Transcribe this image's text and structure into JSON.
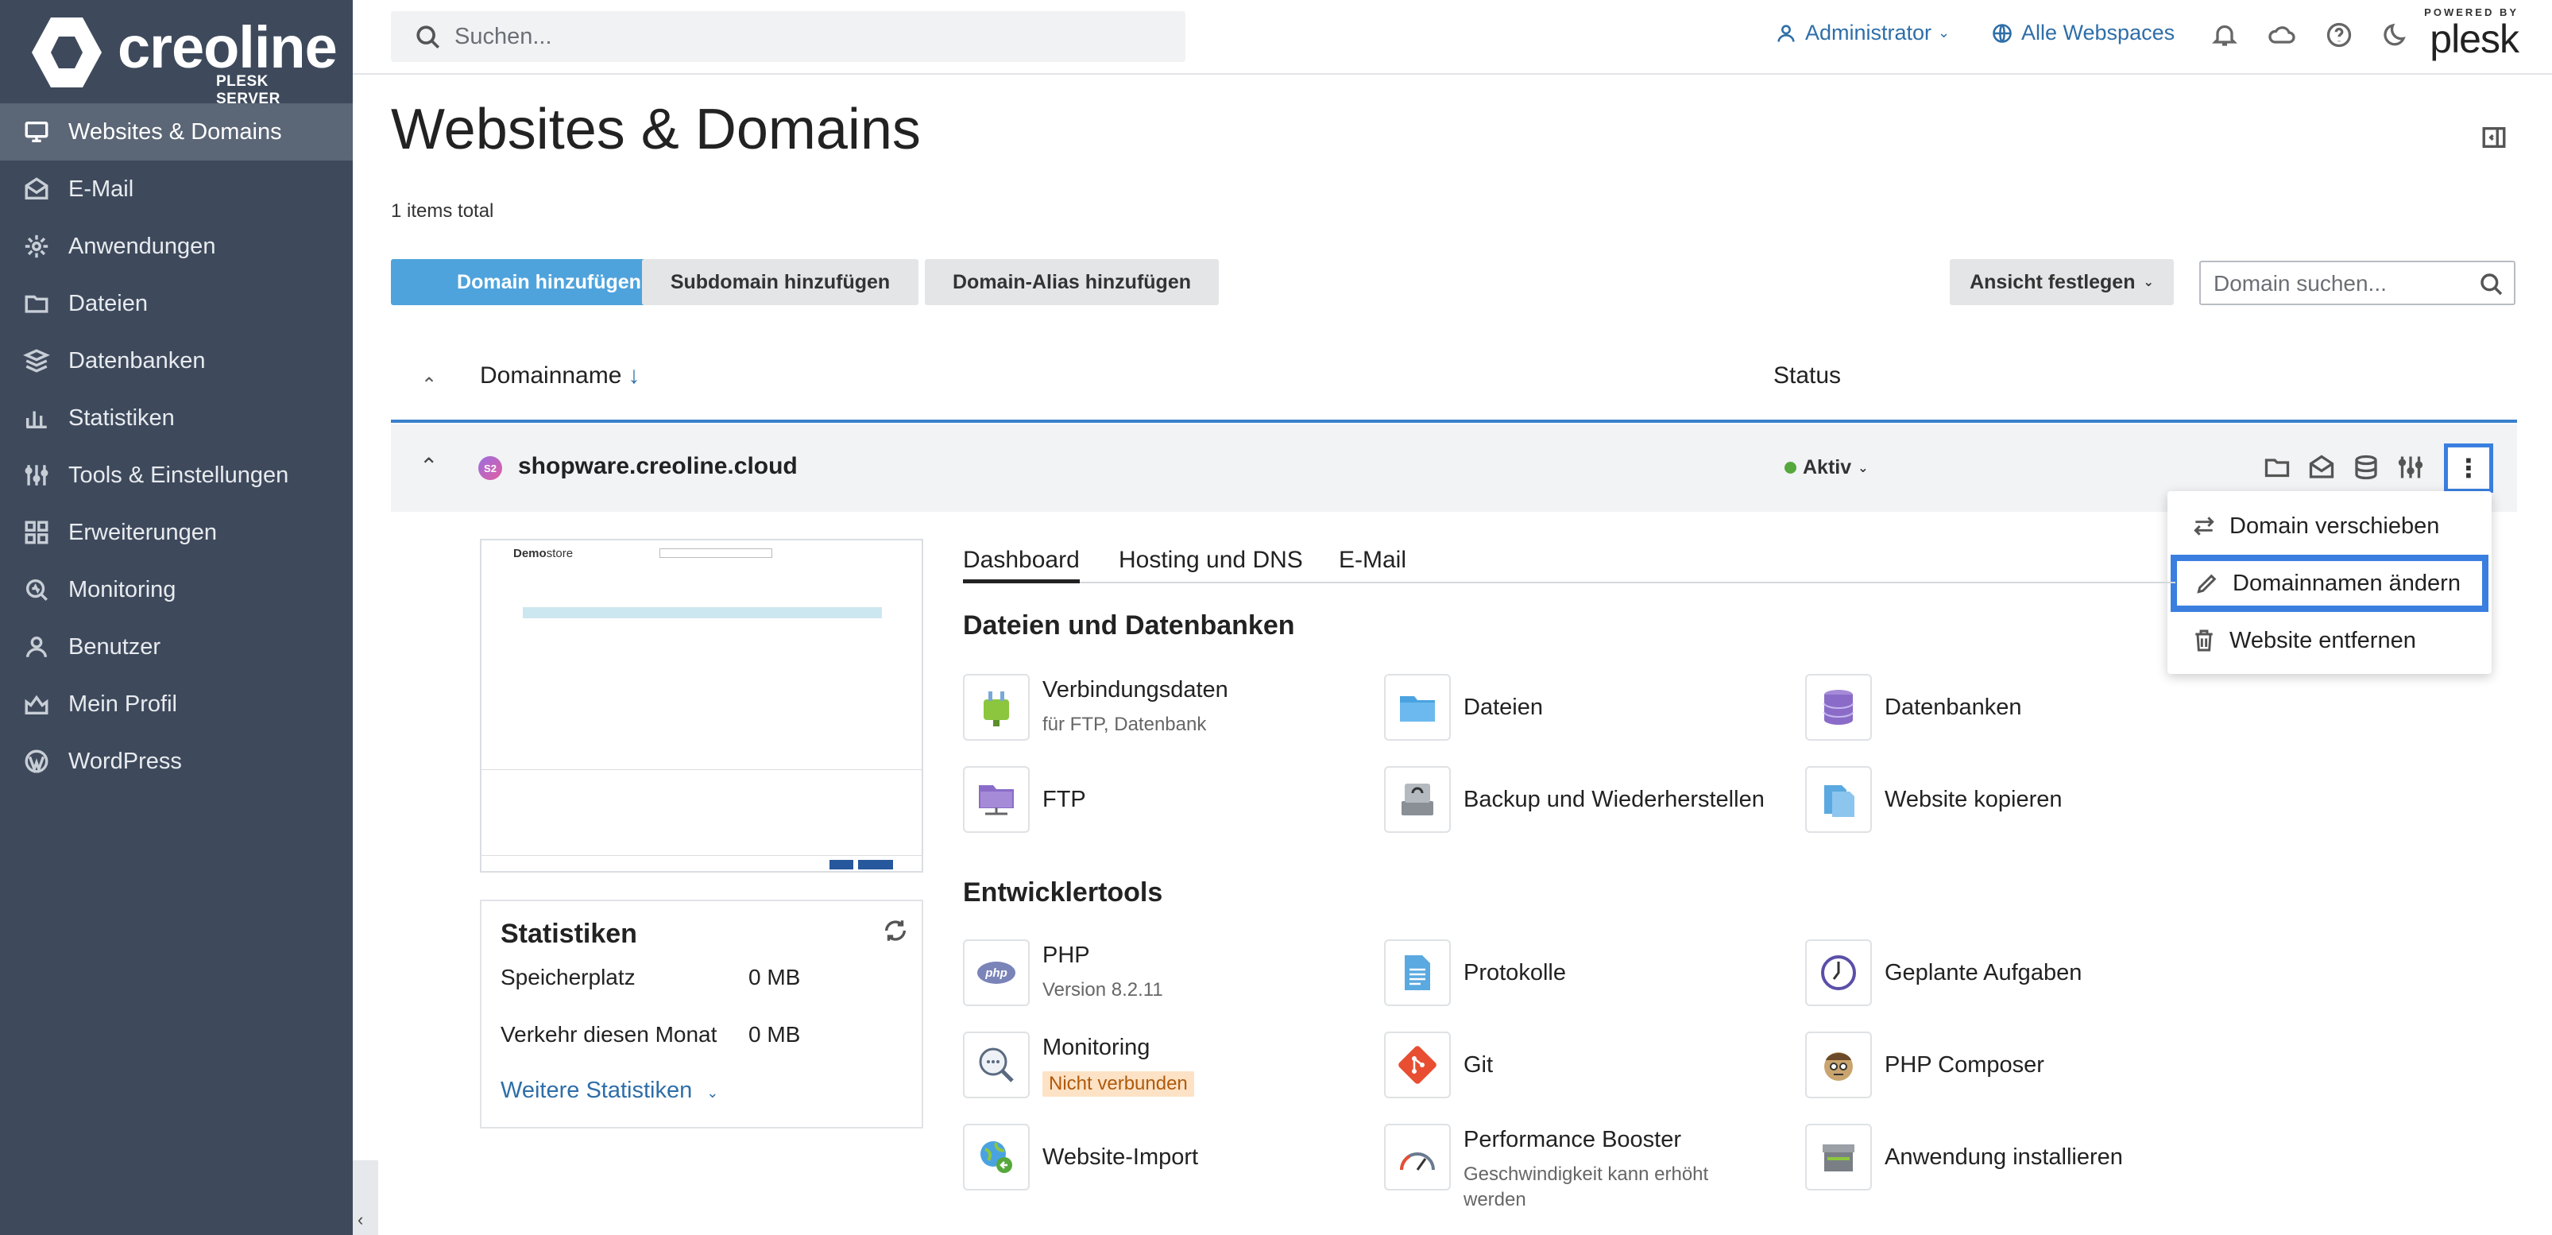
{
  "brand": {
    "name": "creoline",
    "sub": "PLESK SERVER",
    "powered": "POWERED BY",
    "plesk": "plesk"
  },
  "search": {
    "placeholder": "Suchen..."
  },
  "header": {
    "user": "Administrator",
    "webspaces": "Alle Webspaces"
  },
  "sidebar": {
    "items": [
      {
        "label": "Websites & Domains",
        "icon": "monitor-icon",
        "active": true
      },
      {
        "label": "E-Mail",
        "icon": "envelope-icon"
      },
      {
        "label": "Anwendungen",
        "icon": "gear-icon"
      },
      {
        "label": "Dateien",
        "icon": "folder-icon"
      },
      {
        "label": "Datenbanken",
        "icon": "database-icon"
      },
      {
        "label": "Statistiken",
        "icon": "bar-chart-icon"
      },
      {
        "label": "Tools & Einstellungen",
        "icon": "sliders-icon"
      },
      {
        "label": "Erweiterungen",
        "icon": "grid-icon"
      },
      {
        "label": "Monitoring",
        "icon": "monitor-search-icon"
      },
      {
        "label": "Benutzer",
        "icon": "user-icon"
      },
      {
        "label": "Mein Profil",
        "icon": "profile-icon"
      },
      {
        "label": "WordPress",
        "icon": "wordpress-icon"
      }
    ]
  },
  "page": {
    "title": "Websites & Domains",
    "items_total": "1 items total",
    "buttons": {
      "add_domain": "Domain hinzufügen",
      "add_subdomain": "Subdomain hinzufügen",
      "add_alias": "Domain-Alias hinzufügen",
      "view": "Ansicht festlegen"
    },
    "domain_search_placeholder": "Domain suchen..."
  },
  "table": {
    "col_name": "Domainname",
    "sort_indicator": "↓",
    "col_status": "Status",
    "row": {
      "domain": "shopware.creoline.cloud",
      "favicon": "S2",
      "status": "Aktiv",
      "status_color": "#57a83c"
    }
  },
  "menu": {
    "items": [
      {
        "label": "Domain verschieben",
        "icon": "arrows-swap-icon"
      },
      {
        "label": "Domainnamen ändern",
        "icon": "pencil-icon",
        "highlighted": true
      },
      {
        "label": "Website entfernen",
        "icon": "trash-icon"
      }
    ]
  },
  "preview": {
    "logo_bold": "Demo",
    "logo_rest": "store"
  },
  "stats": {
    "title": "Statistiken",
    "rows": [
      {
        "label": "Speicherplatz",
        "value": "0 MB"
      },
      {
        "label": "Verkehr diesen Monat",
        "value": "0 MB"
      }
    ],
    "more": "Weitere Statistiken"
  },
  "tabs": [
    "Dashboard",
    "Hosting und DNS",
    "E-Mail"
  ],
  "sections": {
    "files_title": "Dateien und Datenbanken",
    "dev_title": "Entwicklertools"
  },
  "tools": {
    "verbindungsdaten": {
      "name": "Verbindungsdaten",
      "sub": "für FTP, Datenbank"
    },
    "dateien": {
      "name": "Dateien"
    },
    "datenbanken": {
      "name": "Datenbanken"
    },
    "ftp": {
      "name": "FTP"
    },
    "backup": {
      "name": "Backup und Wiederherstellen"
    },
    "kopieren": {
      "name": "Website kopieren"
    },
    "php": {
      "name": "PHP",
      "sub": "Version 8.2.11"
    },
    "protokolle": {
      "name": "Protokolle"
    },
    "aufgaben": {
      "name": "Geplante Aufgaben"
    },
    "monitoring": {
      "name": "Monitoring",
      "badge": "Nicht verbunden"
    },
    "git": {
      "name": "Git"
    },
    "composer": {
      "name": "PHP Composer"
    },
    "import": {
      "name": "Website-Import"
    },
    "booster": {
      "name": "Performance Booster",
      "sub1": "Geschwindigkeit kann erhöht",
      "sub2": "werden"
    },
    "installieren": {
      "name": "Anwendung installieren"
    }
  },
  "colors": {
    "sidebar": "#3e4a5c",
    "active_nav": "#5b6676",
    "primary": "#4fa3dc",
    "link": "#2e6ea8",
    "highlight": "#3a7fe0"
  }
}
